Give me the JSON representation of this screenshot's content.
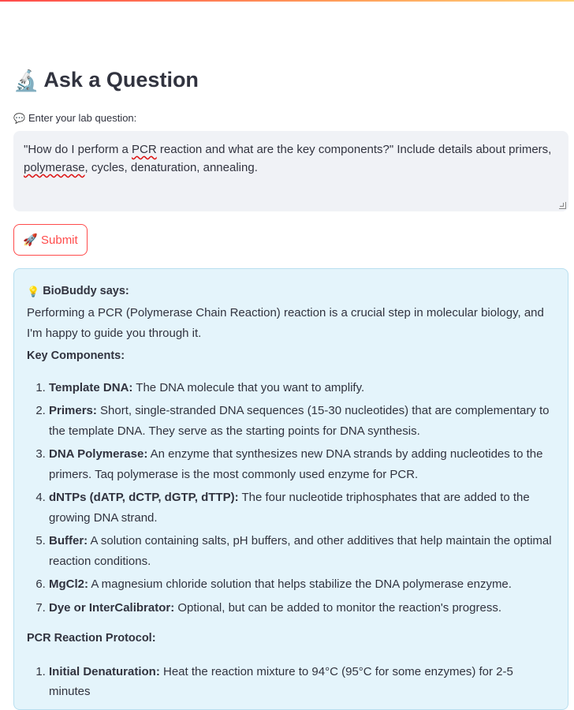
{
  "header": {
    "title": "Ask a Question",
    "title_icon": "🔬"
  },
  "question": {
    "label_icon": "💬",
    "label": "Enter your lab question:",
    "text_before_pcr": "\"How do I perform a ",
    "pcr_word": "PCR",
    "text_after_pcr": " reaction and what are the key components?\" Include details about primers, ",
    "polymerase_word": "polymerase",
    "text_end": ", cycles, denaturation, annealing."
  },
  "submit": {
    "icon": "🚀",
    "label": "Submit"
  },
  "answer": {
    "icon": "💡",
    "speaker": "BioBuddy says:",
    "intro": "Performing a PCR (Polymerase Chain Reaction) reaction is a crucial step in molecular biology, and I'm happy to guide you through it.",
    "components_heading": "Key Components:",
    "components": [
      {
        "term": "Template DNA:",
        "desc": "The DNA molecule that you want to amplify."
      },
      {
        "term": "Primers:",
        "desc": "Short, single-stranded DNA sequences (15-30 nucleotides) that are complementary to the template DNA. They serve as the starting points for DNA synthesis."
      },
      {
        "term": "DNA Polymerase:",
        "desc": "An enzyme that synthesizes new DNA strands by adding nucleotides to the primers. Taq polymerase is the most commonly used enzyme for PCR."
      },
      {
        "term": "dNTPs (dATP, dCTP, dGTP, dTTP):",
        "desc": "The four nucleotide triphosphates that are added to the growing DNA strand."
      },
      {
        "term": "Buffer:",
        "desc": "A solution containing salts, pH buffers, and other additives that help maintain the optimal reaction conditions."
      },
      {
        "term": "MgCl2:",
        "desc": "A magnesium chloride solution that helps stabilize the DNA polymerase enzyme."
      },
      {
        "term": "Dye or InterCalibrator:",
        "desc": "Optional, but can be added to monitor the reaction's progress."
      }
    ],
    "protocol_heading": "PCR Reaction Protocol:",
    "protocol": [
      {
        "term": "Initial Denaturation:",
        "desc": "Heat the reaction mixture to 94°C (95°C for some enzymes) for 2-5 minutes"
      }
    ]
  },
  "colors": {
    "accent": "#ff4b4b",
    "answer_bg": "#e4f4fb",
    "input_bg": "#f0f2f6"
  }
}
